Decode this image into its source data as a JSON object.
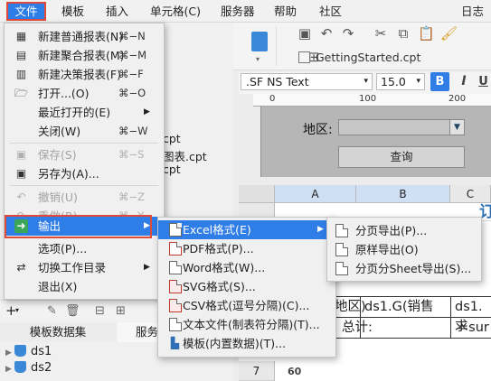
{
  "menubar": {
    "items": [
      "文件",
      "模板",
      "插入",
      "单元格(C)",
      "服务器",
      "帮助",
      "社区",
      "日志"
    ]
  },
  "toolbar": {
    "file_tab": "GettingStarted.cpt",
    "font": ".SF NS Text",
    "font_size": "15.0",
    "bold": "B",
    "italic": "I",
    "underline": "U",
    "ruler": [
      "0",
      "100",
      "200"
    ]
  },
  "param_panel": {
    "area_label": "地区:",
    "query_button": "查询"
  },
  "grid": {
    "columns": [
      "A",
      "B",
      "C"
    ],
    "rows": [
      "3",
      "7"
    ],
    "cells": {
      "r1_tail": "地区)",
      "r1_b": "ds1.G(销售",
      "r1_c": "ds1.求",
      "r2_b": "总计:",
      "r2_c": "=sur",
      "r4_b": "60",
      "title_partial": "订"
    }
  },
  "left_files": [
    "cpt",
    "图表.cpt",
    "cpt"
  ],
  "dataset_panel": {
    "tabs": [
      "模板数据集",
      "服务"
    ],
    "items": [
      "ds1",
      "ds2"
    ]
  },
  "file_menu": {
    "items": [
      {
        "label": "新建普通报表(N)",
        "shortcut": "⌘−N",
        "icon": "new-report-icon",
        "enabled": true
      },
      {
        "label": "新建聚合报表(M)",
        "shortcut": "⌘−M",
        "icon": "new-aggregate-icon",
        "enabled": true
      },
      {
        "label": "新建决策报表(F)",
        "shortcut": "⌘−F",
        "icon": "new-decision-icon",
        "enabled": true
      },
      {
        "label": "打开...(O)",
        "shortcut": "⌘−O",
        "icon": "folder-open-icon",
        "enabled": true
      },
      {
        "label": "最近打开的(E)",
        "shortcut": "",
        "icon": "",
        "enabled": true,
        "submenu": true
      },
      {
        "label": "关闭(W)",
        "shortcut": "⌘−W",
        "icon": "",
        "enabled": true
      },
      {
        "label": "保存(S)",
        "shortcut": "⌘−S",
        "icon": "save-icon",
        "enabled": false
      },
      {
        "label": "另存为(A)...",
        "shortcut": "",
        "icon": "save-as-icon",
        "enabled": true
      },
      {
        "label": "撤销(U)",
        "shortcut": "⌘−Z",
        "icon": "undo-icon",
        "enabled": false
      },
      {
        "label": "重做(R)",
        "shortcut": "⌘−Y",
        "icon": "redo-icon",
        "enabled": false
      },
      {
        "label": "输出",
        "shortcut": "",
        "icon": "export-icon",
        "enabled": true,
        "submenu": true,
        "highlighted": true
      },
      {
        "label": "选项(P)...",
        "shortcut": "",
        "icon": "",
        "enabled": true
      },
      {
        "label": "切换工作目录",
        "shortcut": "",
        "icon": "switch-dir-icon",
        "enabled": true,
        "submenu": true
      },
      {
        "label": "退出(X)",
        "shortcut": "",
        "icon": "",
        "enabled": true
      }
    ]
  },
  "export_menu": {
    "items": [
      {
        "label": "Excel格式(E)",
        "icon": "excel-icon",
        "submenu": true,
        "highlighted": true
      },
      {
        "label": "PDF格式(P)...",
        "icon": "pdf-icon"
      },
      {
        "label": "Word格式(W)...",
        "icon": "word-icon"
      },
      {
        "label": "SVG格式(S)...",
        "icon": "svg-icon"
      },
      {
        "label": "CSV格式(逗号分隔)(C)...",
        "icon": "csv-icon"
      },
      {
        "label": "文本文件(制表符分隔)(T)...",
        "icon": "text-file-icon"
      },
      {
        "label": "模板(内置数据)(T)...",
        "icon": "template-icon"
      }
    ]
  },
  "excel_menu": {
    "items": [
      {
        "label": "分页导出(P)...",
        "icon": "excel-page-icon"
      },
      {
        "label": "原样导出(O)",
        "icon": "excel-original-icon"
      },
      {
        "label": "分页分Sheet导出(S)...",
        "icon": "excel-sheet-icon"
      }
    ]
  },
  "colors": {
    "accent": "#2f7ee8",
    "highlight_box": "#e04a3a"
  }
}
